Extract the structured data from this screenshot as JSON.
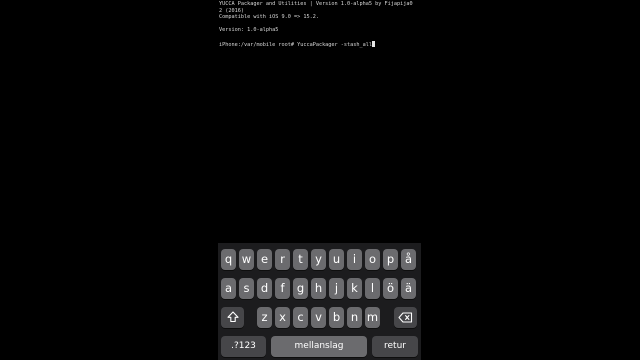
{
  "terminal": {
    "lines": [
      "YUCCA Packager and Utilities | Version 1.0-alpha5 by Fijapija0",
      "2 (2016)",
      "Compatible with iOS 9.0 => 15.2.",
      "",
      "Version: 1.0-alpha5",
      "",
      "iPhone:/var/mobile root# YuccaPackager -stash_all"
    ]
  },
  "keyboard": {
    "row1": [
      "q",
      "w",
      "e",
      "r",
      "t",
      "y",
      "u",
      "i",
      "o",
      "p",
      "å"
    ],
    "row2": [
      "a",
      "s",
      "d",
      "f",
      "g",
      "h",
      "j",
      "k",
      "l",
      "ö",
      "ä"
    ],
    "row3": [
      "z",
      "x",
      "c",
      "v",
      "b",
      "n",
      "m"
    ],
    "shift_icon": "shift-arrow-icon",
    "backspace_icon": "backspace-icon",
    "numbers_label": ".?123",
    "space_label": "mellanslag",
    "return_label": "retur"
  },
  "colors": {
    "background": "#000000",
    "terminal_text": "#d8d8d8",
    "keyboard_bg": "#1c1c1e",
    "key_light": "#6b6b6e",
    "key_dark": "#464649"
  }
}
